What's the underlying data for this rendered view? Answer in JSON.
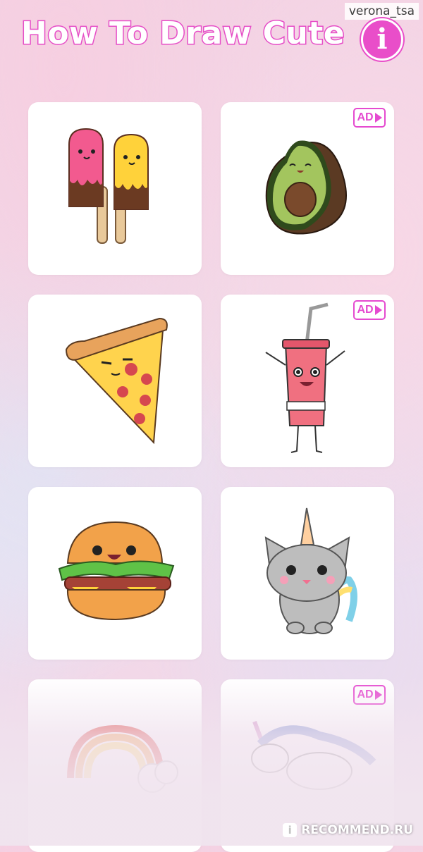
{
  "watermark": "verona_tsa",
  "header": {
    "title": "How To Draw Cute",
    "info_label": "i"
  },
  "cards": [
    {
      "name": "ice-cream",
      "ad": false
    },
    {
      "name": "avocado",
      "ad": true
    },
    {
      "name": "pizza",
      "ad": false
    },
    {
      "name": "soda",
      "ad": true
    },
    {
      "name": "burger",
      "ad": false
    },
    {
      "name": "unicorn-cat",
      "ad": false
    },
    {
      "name": "rainbow",
      "ad": false
    },
    {
      "name": "unicorn",
      "ad": true
    }
  ],
  "ad_label": "AD",
  "footer_watermark": {
    "letter": "i",
    "text": "RECOMMEND.RU"
  },
  "colors": {
    "accent": "#e64dc7",
    "card": "#ffffff"
  }
}
